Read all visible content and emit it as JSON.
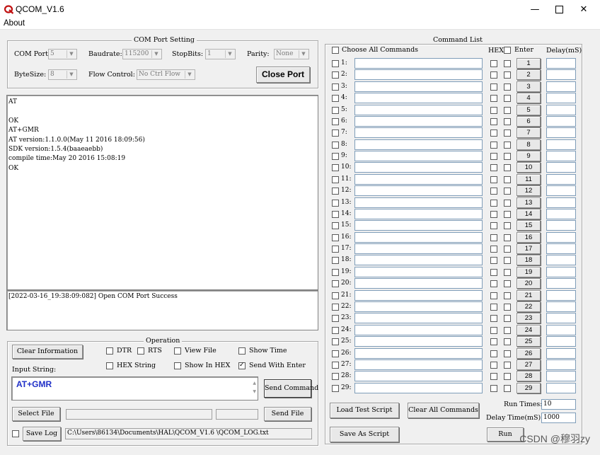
{
  "window": {
    "title": "QCOM_V1.6",
    "minimize_icon": "minimize-icon",
    "maximize_icon": "maximize-icon",
    "close_icon": "close-icon"
  },
  "menu": {
    "about": "About"
  },
  "com_port_setting": {
    "title": "COM Port Setting",
    "com_port_label": "COM Port:",
    "com_port_value": "5",
    "baudrate_label": "Baudrate:",
    "baudrate_value": "115200",
    "stopbits_label": "StopBits:",
    "stopbits_value": "1",
    "parity_label": "Parity:",
    "parity_value": "None",
    "bytesize_label": "ByteSize:",
    "bytesize_value": "8",
    "flow_control_label": "Flow Control:",
    "flow_control_value": "No Ctrl Flow",
    "close_port_button": "Close Port"
  },
  "receive_area": {
    "text": "AT\n\nOK\nAT+GMR\nAT version:1.1.0.0(May 11 2016 18:09:56)\nSDK version:1.5.4(baaeaebb)\ncompile time:May 20 2016 15:08:19\nOK"
  },
  "log_area": {
    "text": "[2022-03-16_19:38:09:082] Open COM Port Success"
  },
  "operation": {
    "title": "Operation",
    "clear_information_button": "Clear Information",
    "dtr_label": "DTR",
    "dtr_checked": false,
    "rts_label": "RTS",
    "rts_checked": false,
    "view_file_label": "View File",
    "view_file_checked": false,
    "show_time_label": "Show Time",
    "show_time_checked": false,
    "hex_string_label": "HEX String",
    "hex_string_checked": false,
    "show_in_hex_label": "Show In HEX",
    "show_in_hex_checked": false,
    "send_with_enter_label": "Send With Enter",
    "send_with_enter_checked": true,
    "input_string_label": "Input String:",
    "input_string_value": "AT+GMR",
    "send_command_button": "Send Command",
    "select_file_button": "Select File",
    "send_file_button": "Send File",
    "save_log_label": "Save Log",
    "save_log_checked": false,
    "log_path": "C:\\Users\\86134\\Documents\\HAL\\QCOM_V1.6 \\QCOM_LOG.txt"
  },
  "command_list": {
    "title": "Command List",
    "choose_all_label": "Choose All Commands",
    "hex_header": "HEX",
    "enter_header": "Enter",
    "delay_header": "Delay(mS)",
    "rows": [
      {
        "label": "1:",
        "button": "1"
      },
      {
        "label": "2:",
        "button": "2"
      },
      {
        "label": "3:",
        "button": "3"
      },
      {
        "label": "4:",
        "button": "4"
      },
      {
        "label": "5:",
        "button": "5"
      },
      {
        "label": "6:",
        "button": "6"
      },
      {
        "label": "7:",
        "button": "7"
      },
      {
        "label": "8:",
        "button": "8"
      },
      {
        "label": "9:",
        "button": "9"
      },
      {
        "label": "10:",
        "button": "10"
      },
      {
        "label": "11:",
        "button": "11"
      },
      {
        "label": "12:",
        "button": "12"
      },
      {
        "label": "13:",
        "button": "13"
      },
      {
        "label": "14:",
        "button": "14"
      },
      {
        "label": "15:",
        "button": "15"
      },
      {
        "label": "16:",
        "button": "16"
      },
      {
        "label": "17:",
        "button": "17"
      },
      {
        "label": "18:",
        "button": "18"
      },
      {
        "label": "19:",
        "button": "19"
      },
      {
        "label": "20:",
        "button": "20"
      },
      {
        "label": "21:",
        "button": "21"
      },
      {
        "label": "22:",
        "button": "22"
      },
      {
        "label": "23:",
        "button": "23"
      },
      {
        "label": "24:",
        "button": "24"
      },
      {
        "label": "25:",
        "button": "25"
      },
      {
        "label": "26:",
        "button": "26"
      },
      {
        "label": "27:",
        "button": "27"
      },
      {
        "label": "28:",
        "button": "28"
      },
      {
        "label": "29:",
        "button": "29"
      }
    ],
    "load_test_script_button": "Load Test Script",
    "clear_all_commands_button": "Clear All Commands",
    "save_as_script_button": "Save As Script",
    "run_times_label": "Run Times:",
    "run_times_value": "10",
    "delay_time_label": "Delay Time(mS):",
    "delay_time_value": "1000",
    "run_button": "Run"
  },
  "watermark": "CSDN @穆羽zy",
  "colors": {
    "input_text": "#1f2fc7",
    "window_bg": "#f0f0f0"
  }
}
